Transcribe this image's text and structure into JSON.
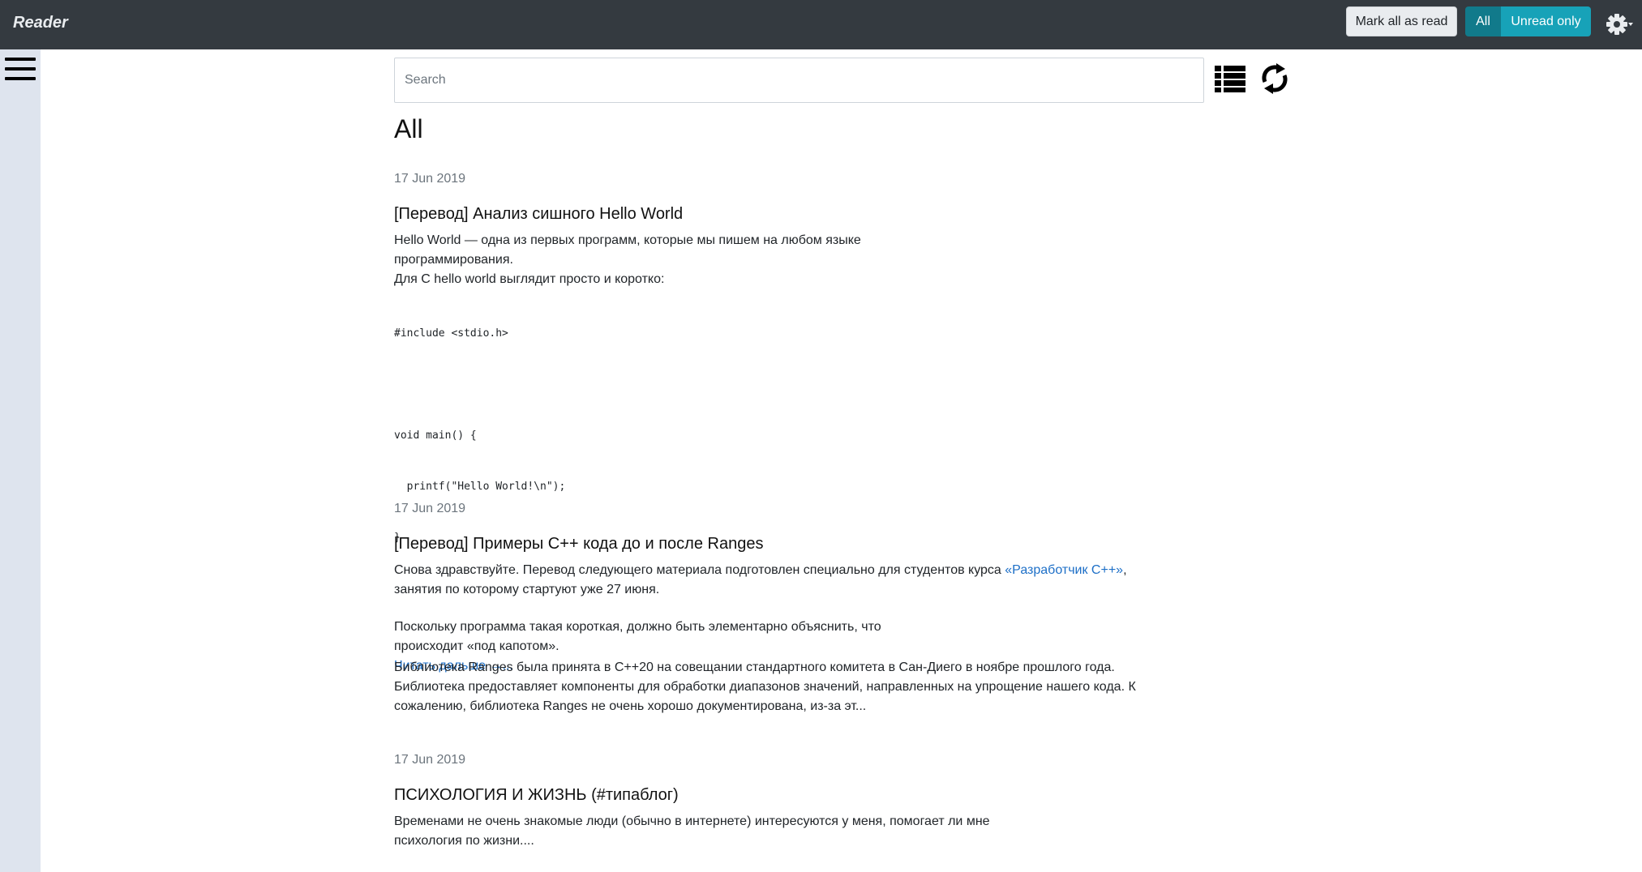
{
  "app": {
    "brand": "Reader"
  },
  "toolbar": {
    "mark_all_label": "Mark all as read",
    "filter_all_label": "All",
    "filter_unread_label": "Unread only"
  },
  "search": {
    "placeholder": "Search"
  },
  "page": {
    "title": "All"
  },
  "articles": [
    {
      "date": "17 Jun 2019",
      "title": "[Перевод] Анализ сишного Hello World",
      "p1_l1": "Hello World — одна из первых программ, которые мы пишем на любом языке",
      "p1_l2": "программирования.",
      "p1_l3": "Для C hello world выглядит просто и коротко:",
      "code": [
        "#include <stdio.h>",
        "",
        "void main() {",
        "  printf(\"Hello World!\\n\");",
        "}"
      ],
      "p2_l1": "Поскольку программа такая короткая, должно быть элементарно объяснить, что",
      "p2_l2": "происходит «под капотом».",
      "read_more": "Читать дальше →..."
    },
    {
      "date": "17 Jun 2019",
      "title": "[Перевод] Примеры C++ кода до и после Ranges",
      "p1_pre": "Снова здравствуйте. Перевод следующего материала подготовлен специально для студентов курса ",
      "p1_link": "«Разработчик C++»",
      "p1_post": ",",
      "p1_l2": "занятия по которому стартуют уже 27 июня.",
      "p2_l1": "Библиотека Ranges была принята в C++20 на совещании стандартного комитета в Сан-Диего в ноябре прошлого года.",
      "p2_l2": "Библиотека предоставляет компоненты для обработки диапазонов значений, направленных на упрощение нашего кода. К",
      "p2_l3": "сожалению, библиотека Ranges не очень хорошо документирована, из-за эт..."
    },
    {
      "date": "17 Jun 2019",
      "title": "ПСИХОЛОГИЯ И ЖИЗНЬ (#типаблог)",
      "p1_l1": "Временами не очень знакомые люди (обычно в интернете) интересуются у меня, помогает ли мне",
      "p1_l2": "психология по жизни...."
    }
  ],
  "icons": {
    "menu": "hamburger-icon",
    "settings": "gear-icon",
    "view": "list-view-icon",
    "refresh": "refresh-icon"
  },
  "colors": {
    "topbar": "#343a40",
    "sidebar": "#dee4ee",
    "accent": "#17a2b8",
    "accent_active": "#117a8b",
    "link": "#1d6fc7"
  }
}
